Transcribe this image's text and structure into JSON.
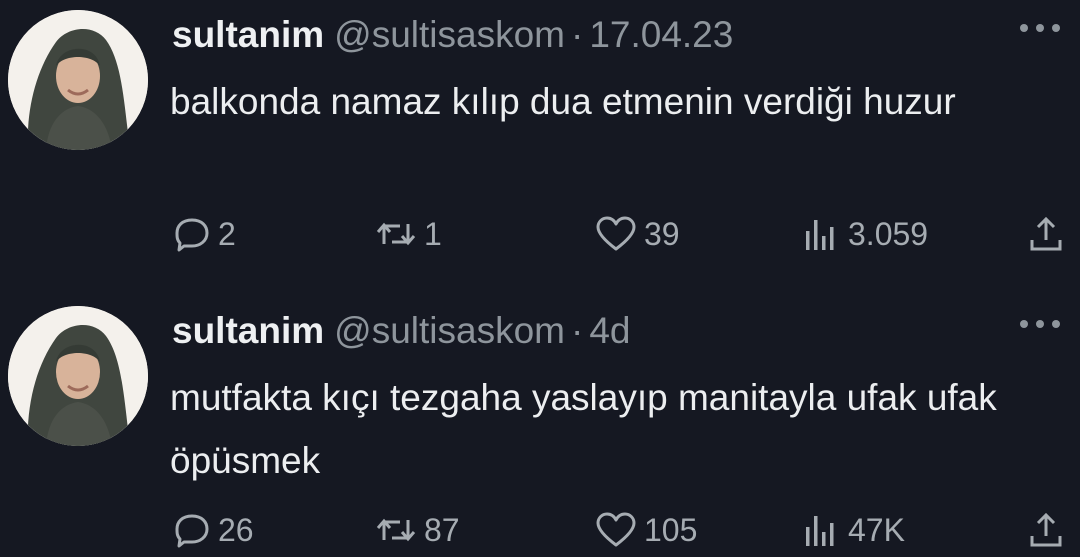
{
  "tweets": [
    {
      "name": "sultanim",
      "handle": "@sultisaskom",
      "separator": "·",
      "time": "17.04.23",
      "text": "balkonda namaz kılıp dua etmenin verdiği huzur",
      "replies": "2",
      "retweets": "1",
      "likes": "39",
      "views": "3.059"
    },
    {
      "name": "sultanim",
      "handle": "@sultisaskom",
      "separator": "·",
      "time": "4d",
      "text": "mutfakta kıçı tezgaha yaslayıp manitayla ufak ufak öpüsmek",
      "replies": "26",
      "retweets": "87",
      "likes": "105",
      "views": "47K"
    }
  ],
  "icons": {
    "reply": "speech-bubble-icon",
    "retweet": "retweet-arrows-icon",
    "like": "heart-icon",
    "views": "bar-chart-icon",
    "share": "share-upload-icon",
    "more": "more-dots-icon"
  },
  "colors": {
    "background": "#151822",
    "primary_text": "#e7e9ea",
    "secondary_text": "#8e959c",
    "icon": "#a6acb2"
  }
}
